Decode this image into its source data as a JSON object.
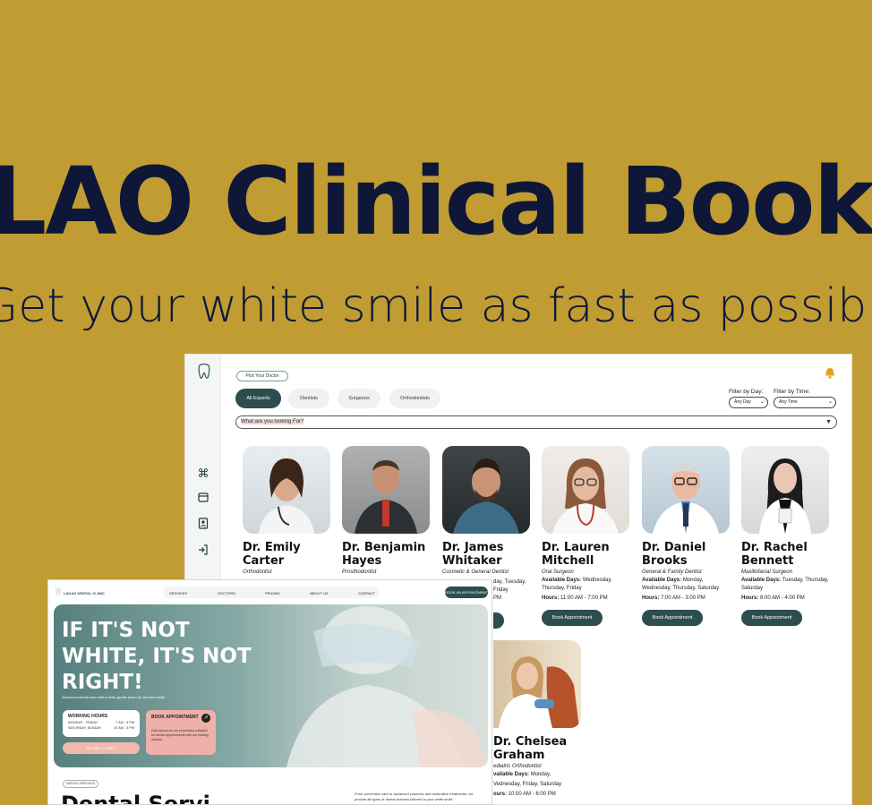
{
  "promo": {
    "title": "LAO Clinical Book",
    "subtitle": "Get your white smile as fast as possib"
  },
  "app": {
    "pick_doctor": "Pick Your Doctor",
    "tabs": [
      "All Experts",
      "Dentists",
      "Surgeons",
      "Orthodontists"
    ],
    "filter_day_label": "Filter by Day:",
    "filter_day_value": "Any Day",
    "filter_time_label": "Filter by Time:",
    "filter_time_value": "Any Time",
    "search_placeholder": "What are you looking For?",
    "book_label": "Book Appointment",
    "doctors": [
      {
        "name": "Dr. Emily Carter",
        "specialty": "Orthodontist",
        "days": "",
        "hours": ""
      },
      {
        "name": "Dr. Benjamin Hayes",
        "specialty": "Prosthodontist",
        "days": "",
        "hours": ""
      },
      {
        "name": "Dr. James Whitaker",
        "specialty": "Cosmetic & General Dentist",
        "days": "",
        "hours": ""
      },
      {
        "name": "Dr. Lauren Mitchell",
        "specialty": "Oral Surgeon",
        "days": "Wednesday, Thursday, Friday",
        "hours": "11:00 AM - 7:00 PM"
      },
      {
        "name": "Dr. Daniel Brooks",
        "specialty": "General & Family Dentist",
        "days": "Monday, Wednesday, Thursday, Saturday",
        "hours": "7:00 AM - 3:00 PM"
      },
      {
        "name": "Dr. Rachel Bennett",
        "specialty": "Maxillofacial Surgeon",
        "days": "Tuesday, Thursday, Saturday",
        "hours": "8:00 AM - 4:00 PM"
      },
      {
        "name": "Dr. Chelsea Graham",
        "specialty": "Pediatric Orthodontist",
        "days": "Monday, Wednesday, Friday, Saturday",
        "hours": "10:00 AM - 6:00 PM"
      }
    ],
    "partial": {
      "james_days": "day, Tuesday,",
      "james_days2": "Friday",
      "james_hours": "PM",
      "chelsea_days_label": "vailable Days:",
      "chelsea_hours_label": "ours:",
      "chelsea_spec": "ediatric Orthodontist",
      "chelsea_days": "Monday,",
      "chelsea_days2": "Vednesday, Friday, Saturday"
    },
    "labels": {
      "available_days": "Available Days:",
      "hours": "Hours:"
    }
  },
  "site": {
    "logo": "LAKAO DENTAL CLINIC",
    "nav": [
      "SERVICES",
      "DOCTORS",
      "PRICING",
      "ABOUT US",
      "CONTACT"
    ],
    "book_button": "BOOK AN APPOINTMENT",
    "hero_heading": "IF IT'S NOT WHITE, IT'S NOT RIGHT!",
    "hero_tagline": "Advanced dental care with a white gentle touch for the best smile.",
    "hours_title": "WORKING HOURS",
    "hours": [
      {
        "day": "MONDAY - FRIDAY",
        "time": "7 AM - 9 PM"
      },
      {
        "day": "SATURDAY, SUNDAY",
        "time": "10 AM - 3 PM"
      }
    ],
    "contact_button": "WE ARE CLOSED",
    "book_card_title": "BOOK APPOINTMENT",
    "book_card_desc": "Gain access to our proprietary software for dental appointments with our leading doctors.",
    "section_pill": "DENTAL SERVICES",
    "section_title": "Dental Servi",
    "section_desc": "From preventive care to advanced cosmetic and restorative treatments, we provide all types of dental services tailored to your white smile"
  },
  "colors": {
    "background": "#c09c32",
    "title": "#0e1738",
    "accent": "#2d4d4f",
    "pink": "#eeb0a8",
    "bell": "#e3a21b"
  }
}
